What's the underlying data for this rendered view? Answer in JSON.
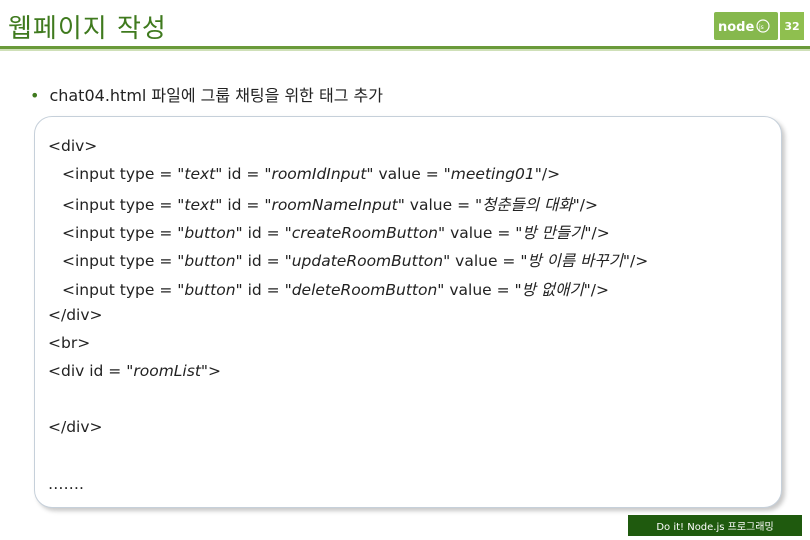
{
  "slide": {
    "title": "웹페이지 작성",
    "page_number": "32",
    "logo_text": "node",
    "logo_suffix": "js"
  },
  "bullet": {
    "symbol": "•",
    "text": "chat04.html 파일에 그룹 채팅을 위한 태그 추가"
  },
  "code": {
    "div_open": "<div>",
    "line1_pre": "<input type = ",
    "line1_type": "\"text\"",
    "line1_mid": " id = ",
    "line1_id": "\"roomIdInput\"",
    "line1_val_label": " value = ",
    "line1_val": "\"meeting01\"",
    "line1_end": "/>",
    "line2_pre": "<input type = ",
    "line2_type": "\"text\"",
    "line2_mid": " id = ",
    "line2_id": "\"roomNameInput\"",
    "line2_val_label": " value = ",
    "line2_val": "\"청춘들의 대화\"",
    "line2_end": "/>",
    "line3_pre": "<input type = ",
    "line3_type": "\"button\"",
    "line3_mid": " id = ",
    "line3_id": "\"createRoomButton\"",
    "line3_val_label": " value = ",
    "line3_val": "\"방 만들기\"",
    "line3_end": "/>",
    "line4_pre": "<input type = ",
    "line4_type": "\"button\"",
    "line4_mid": " id = ",
    "line4_id": "\"updateRoomButton\"",
    "line4_val_label": " value = ",
    "line4_val": "\"방 이름 바꾸기\"",
    "line4_end": "/>",
    "line5_pre": "<input type = ",
    "line5_type": "\"button\"",
    "line5_mid": " id = ",
    "line5_id": "\"deleteRoomButton\"",
    "line5_val_label": " value = ",
    "line5_val": "\"방 없애기\"",
    "line5_end": "/>",
    "div_close": "</div>",
    "br": "<br>",
    "div_list_pre": "<div id = ",
    "div_list_id": "\"roomList\"",
    "div_list_end": ">",
    "div_list_close": "</div>",
    "ellipsis": "……."
  },
  "footer": {
    "text": "Do it! Node.js 프로그래밍"
  },
  "colors": {
    "title_green": "#3f7a1e",
    "rule_green": "#6a9a3a",
    "logo_green": "#86b84d",
    "footer_green": "#1f5a0e"
  }
}
